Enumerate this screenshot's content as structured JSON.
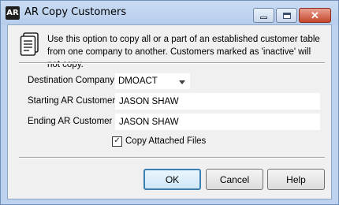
{
  "window": {
    "icon_text": "AR",
    "title": "AR Copy Customers",
    "close_glyph": "✕"
  },
  "info": {
    "icon": "document-icon",
    "text": "Use this option to copy all or a part of an established customer table from one company to another. Customers marked as 'inactive' will not copy."
  },
  "form": {
    "destination_label": "Destination Company",
    "destination_value": "DMOACT",
    "starting_label": "Starting AR Customer",
    "starting_value": "JASON SHAW",
    "ending_label": "Ending AR Customer",
    "ending_value": "JASON SHAW",
    "copy_files_label": "Copy Attached Files",
    "copy_files_checked": true,
    "check_glyph": "✓"
  },
  "buttons": {
    "ok": "OK",
    "cancel": "Cancel",
    "help": "Help"
  },
  "colors": {
    "frame": "#bcd2ee",
    "client": "#f0f0f0",
    "close_red": "#c6472e",
    "default_button_border": "#3c7fb1"
  }
}
